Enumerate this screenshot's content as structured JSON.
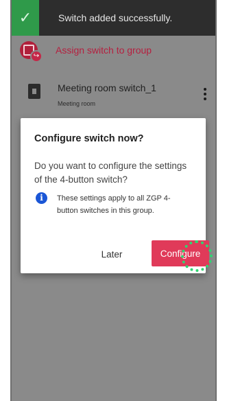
{
  "toast": {
    "check_icon": "check-icon",
    "message": "Switch added successfully."
  },
  "assign": {
    "icon": "assign-group-icon",
    "label": "Assign switch to group"
  },
  "switch_item": {
    "icon": "wall-switch-icon",
    "title": "Meeting room switch_1",
    "subtitle": "Meeting room",
    "menu_icon": "more-vertical-icon"
  },
  "dialog": {
    "title": "Configure switch now?",
    "body": "Do you want to configure the settings of the 4-button switch?",
    "info_icon": "info-icon",
    "info_glyph": "i",
    "info_text": "These settings apply to all ZGP 4-button switches in this group.",
    "later_label": "Later",
    "configure_label": "Configure"
  },
  "colors": {
    "accent": "#e03a59",
    "success": "#2f9a4a",
    "info": "#1a56d6",
    "tap_indicator": "#2fd672"
  }
}
